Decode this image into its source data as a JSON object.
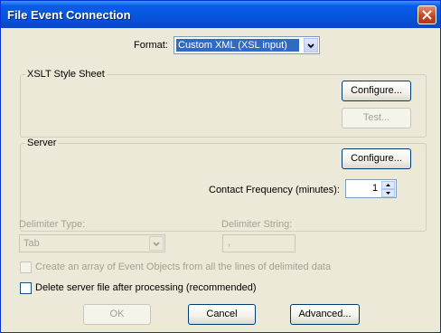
{
  "window": {
    "title": "File Event Connection"
  },
  "format": {
    "label": "Format:",
    "selected": "Custom XML (XSL input)"
  },
  "xslt": {
    "title": "XSLT Style Sheet",
    "configure_label": "Configure...",
    "test_label": "Test..."
  },
  "server": {
    "title": "Server",
    "configure_label": "Configure...",
    "contact_label": "Contact Frequency (minutes):",
    "contact_value": "1"
  },
  "delimiter": {
    "type_label": "Delimiter Type:",
    "type_value": "Tab",
    "string_label": "Delimiter String:",
    "string_value": ","
  },
  "options": {
    "array_label": "Create an array of Event Objects from all the lines of delimited data",
    "delete_label": "Delete server file after processing (recommended)"
  },
  "buttons": {
    "ok": "OK",
    "cancel": "Cancel",
    "advanced": "Advanced..."
  },
  "colors": {
    "titlebar": "#0552d8",
    "selection": "#316ac5",
    "face": "#ece9d8"
  },
  "icons": [
    "close-icon",
    "chevron-down-icon",
    "spin-up-icon",
    "spin-down-icon"
  ]
}
